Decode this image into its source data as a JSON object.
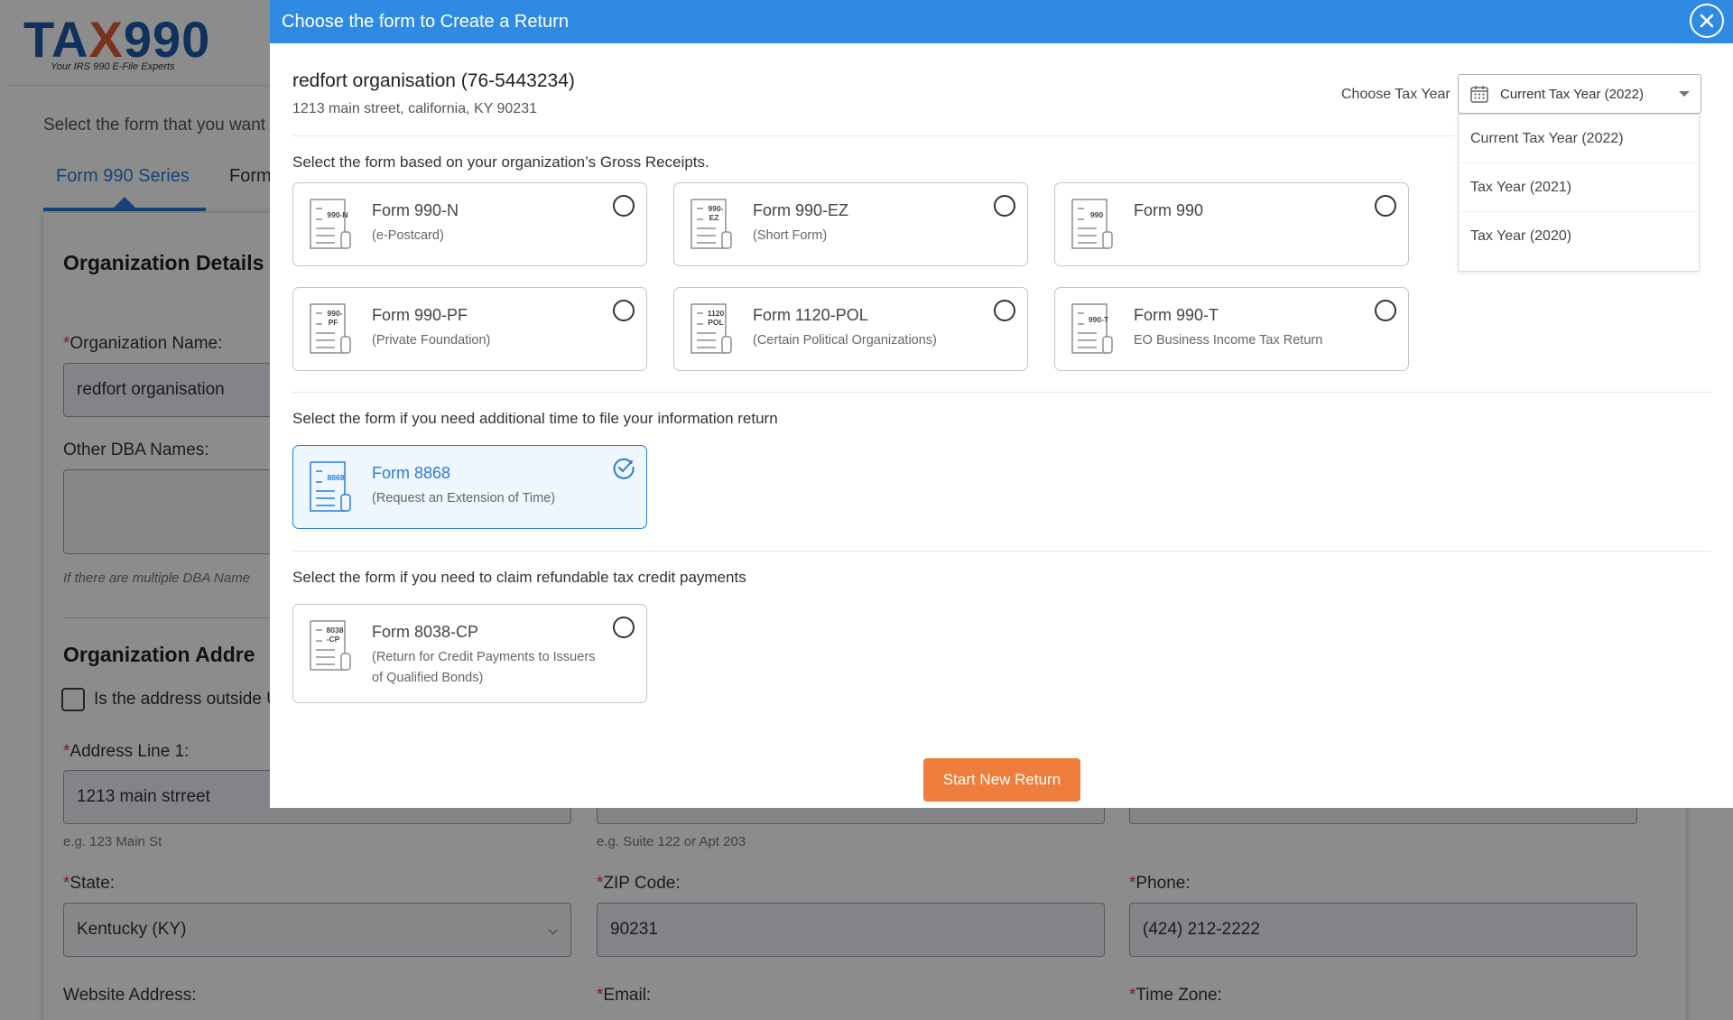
{
  "background": {
    "logo": {
      "text_a": "TA",
      "text_x": "X",
      "text_b": "990",
      "tagline": "Your IRS 990 E-File Experts"
    },
    "instruction": "Select the form that you want to",
    "series_tabs": [
      "Form 990 Series",
      "Form"
    ],
    "sections": {
      "org_details": "Organization Details",
      "org_address": "Organization Addre"
    },
    "fields": {
      "org_name_label": "Organization Name:",
      "org_name_value": "redfort organisation",
      "dba_label": "Other DBA Names:",
      "dba_hint": "If there are multiple DBA Name",
      "address_outside_label": "Is the address outside U",
      "address1_label": "Address Line 1:",
      "address1_value": "1213 main strreet",
      "address1_hint": "e.g. 123 Main St",
      "address2_hint": "e.g. Suite 122 or Apt 203",
      "state_label": "State:",
      "state_value": "Kentucky (KY)",
      "zip_label": "ZIP Code:",
      "zip_value": "90231",
      "phone_label": "Phone:",
      "phone_value": "(424) 212-2222",
      "website_label": "Website Address:",
      "email_label": "Email:",
      "timezone_label": "Time Zone:",
      "required_mark": "*"
    }
  },
  "modal": {
    "title": "Choose the form to Create a Return",
    "org_name": "redfort organisation (76-5443234)",
    "org_address": "1213 main street, california, KY 90231",
    "tax_year_label": "Choose Tax Year",
    "tax_year_selected": "Current Tax Year (2022)",
    "tax_year_options": [
      "Current Tax Year (2022)",
      "Tax Year (2021)",
      "Tax Year (2020)"
    ],
    "section_gross": "Select the form based on your organization’s Gross Receipts.",
    "section_extension": "Select the form if you need additional time to file your information return",
    "section_credit": "Select the form if you need to claim refundable tax credit payments",
    "forms": [
      {
        "code": "990-N",
        "name": "Form 990-N",
        "sub": "(e-Postcard)"
      },
      {
        "code": "990-EZ",
        "name": "Form 990-EZ",
        "sub": "(Short Form)"
      },
      {
        "code": "990",
        "name": "Form 990",
        "sub": ""
      },
      {
        "code": "990-PF",
        "name": "Form 990-PF",
        "sub": "(Private Foundation)"
      },
      {
        "code": "1120 POL",
        "name": "Form 1120-POL",
        "sub": "(Certain Political Organizations)"
      },
      {
        "code": "990-T",
        "name": "Form 990-T",
        "sub": "EO Business Income Tax Return"
      },
      {
        "code": "8868",
        "name": "Form 8868",
        "sub": "(Request an Extension of Time)"
      },
      {
        "code": "8038-CP",
        "name": "Form 8038-CP",
        "sub": "(Return for Credit Payments to Issuers of Qualified Bonds)"
      }
    ],
    "selected_form": "Form 8868",
    "start_button": "Start New Return"
  },
  "colors": {
    "header": "#2f8ae4",
    "accent": "#2a7dd6",
    "button": "#ef7d3b"
  }
}
